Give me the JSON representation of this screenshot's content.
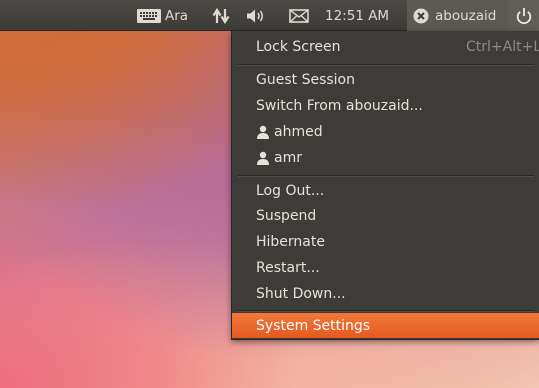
{
  "topbar": {
    "keyboard_label": "Ara",
    "clock": "12:51 AM",
    "username": "abouzaid"
  },
  "menu": {
    "lock_screen": "Lock Screen",
    "lock_shortcut": "Ctrl+Alt+L",
    "guest_session": "Guest Session",
    "switch_from": "Switch From abouzaid...",
    "users": [
      "ahmed",
      "amr"
    ],
    "log_out": "Log Out...",
    "suspend": "Suspend",
    "hibernate": "Hibernate",
    "restart": "Restart...",
    "shut_down": "Shut Down...",
    "system_settings": "System Settings"
  },
  "colors": {
    "panel": "#3c3b37",
    "highlight": "#e96b2c",
    "menu_text": "#e6e3db"
  },
  "icons": [
    "keyboard-icon",
    "network-icon",
    "volume-icon",
    "mail-icon",
    "user-status-icon",
    "power-icon",
    "person-icon"
  ]
}
